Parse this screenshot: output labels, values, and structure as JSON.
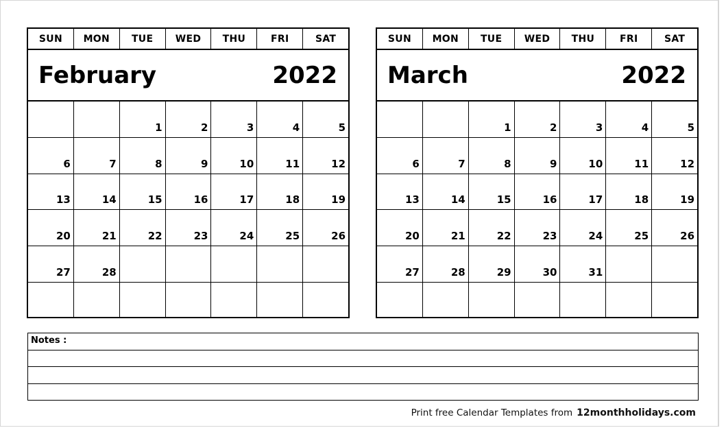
{
  "weekdays": [
    "SUN",
    "MON",
    "TUE",
    "WED",
    "THU",
    "FRI",
    "SAT"
  ],
  "calendars": [
    {
      "month": "February",
      "year": "2022",
      "weeks": [
        [
          "",
          "",
          "1",
          "2",
          "3",
          "4",
          "5"
        ],
        [
          "6",
          "7",
          "8",
          "9",
          "10",
          "11",
          "12"
        ],
        [
          "13",
          "14",
          "15",
          "16",
          "17",
          "18",
          "19"
        ],
        [
          "20",
          "21",
          "22",
          "23",
          "24",
          "25",
          "26"
        ],
        [
          "27",
          "28",
          "",
          "",
          "",
          "",
          ""
        ],
        [
          "",
          "",
          "",
          "",
          "",
          "",
          ""
        ]
      ]
    },
    {
      "month": "March",
      "year": "2022",
      "weeks": [
        [
          "",
          "",
          "1",
          "2",
          "3",
          "4",
          "5"
        ],
        [
          "6",
          "7",
          "8",
          "9",
          "10",
          "11",
          "12"
        ],
        [
          "13",
          "14",
          "15",
          "16",
          "17",
          "18",
          "19"
        ],
        [
          "20",
          "21",
          "22",
          "23",
          "24",
          "25",
          "26"
        ],
        [
          "27",
          "28",
          "29",
          "30",
          "31",
          "",
          ""
        ],
        [
          "",
          "",
          "",
          "",
          "",
          "",
          ""
        ]
      ]
    }
  ],
  "notes": {
    "label": "Notes :",
    "line_count": 4
  },
  "footer": {
    "text": "Print free Calendar Templates from",
    "site": "12monthholidays.com"
  }
}
